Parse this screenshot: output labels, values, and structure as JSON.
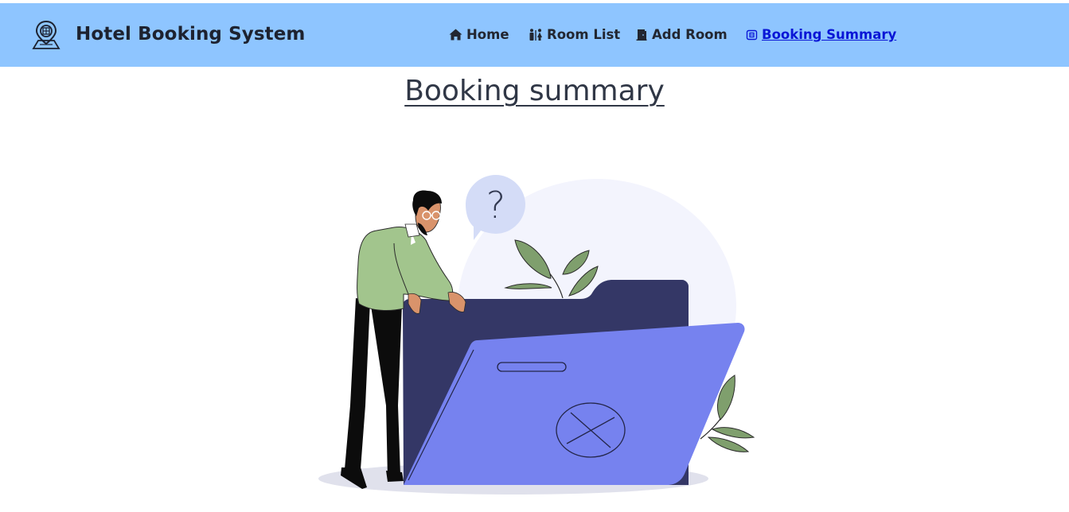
{
  "navbar": {
    "brand_title": "Hotel Booking System",
    "logo_icon": "hotel-map-pin-icon",
    "background": "#8ec5ff",
    "items": [
      {
        "label": "Home",
        "icon": "home-icon",
        "active": false
      },
      {
        "label": "Room List",
        "icon": "people-icon",
        "active": false
      },
      {
        "label": "Add Room",
        "icon": "door-icon",
        "active": false
      },
      {
        "label": "Booking Summary",
        "icon": "ticket-icon",
        "active": true
      }
    ],
    "active_color": "#0a16d6"
  },
  "main": {
    "title": "Booking summary",
    "illustration": "empty-folder-confused-man-illustration"
  },
  "colors": {
    "folder_front": "#7682ef",
    "folder_back": "#343766",
    "leaf": "#7f9f6d",
    "shirt": "#a2c58d"
  }
}
